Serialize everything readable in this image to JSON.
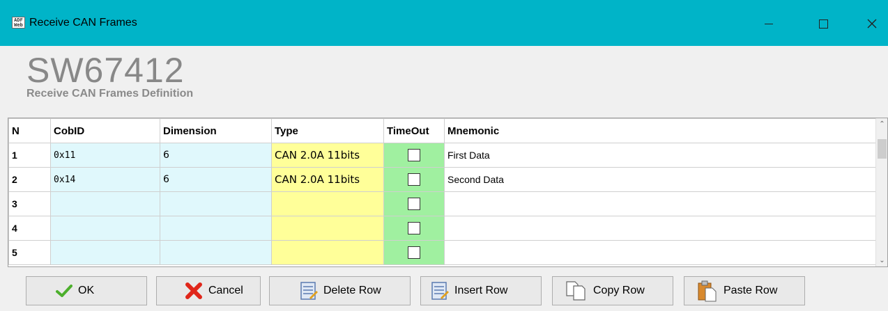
{
  "window": {
    "title": "Receive CAN Frames",
    "app_icon_text_1": "ADF",
    "app_icon_text_2": "Web"
  },
  "header": {
    "product": "SW67412",
    "subtitle": "Receive CAN Frames Definition"
  },
  "table": {
    "columns": [
      "N",
      "CobID",
      "Dimension",
      "Type",
      "TimeOut",
      "Mnemonic"
    ],
    "rows": [
      {
        "n": "1",
        "cobid": "0x11",
        "dimension": "6",
        "type": "CAN 2.0A 11bits",
        "timeout": false,
        "mnemonic": "First Data"
      },
      {
        "n": "2",
        "cobid": "0x14",
        "dimension": "6",
        "type": "CAN 2.0A 11bits",
        "timeout": false,
        "mnemonic": "Second Data"
      },
      {
        "n": "3",
        "cobid": "",
        "dimension": "",
        "type": "",
        "timeout": false,
        "mnemonic": ""
      },
      {
        "n": "4",
        "cobid": "",
        "dimension": "",
        "type": "",
        "timeout": false,
        "mnemonic": ""
      },
      {
        "n": "5",
        "cobid": "",
        "dimension": "",
        "type": "",
        "timeout": false,
        "mnemonic": ""
      }
    ]
  },
  "buttons": {
    "ok": "OK",
    "cancel": "Cancel",
    "delete_row": "Delete Row",
    "insert_row": "Insert Row",
    "copy_row": "Copy Row",
    "paste_row": "Paste Row"
  },
  "colors": {
    "titlebar": "#00b4c8",
    "cobid_bg": "#e0f8fc",
    "type_bg": "#ffff99",
    "timeout_bg": "#a0f0a0"
  }
}
